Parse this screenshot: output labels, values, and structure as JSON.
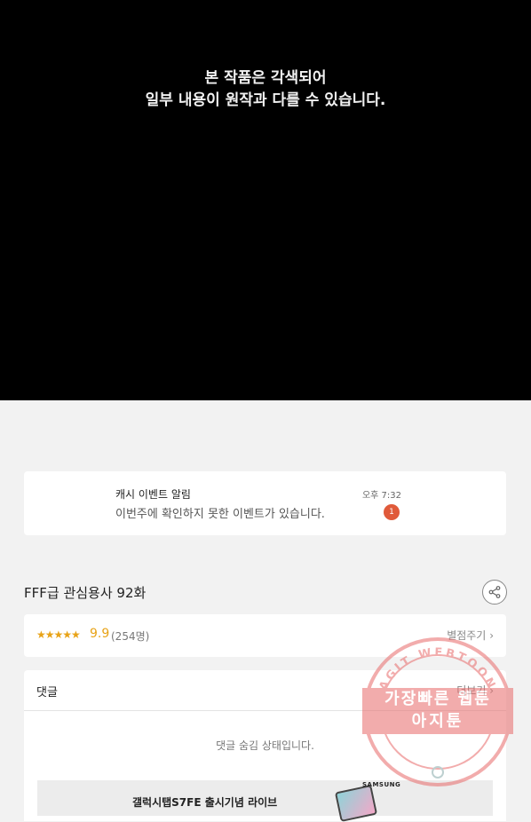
{
  "viewer": {
    "notice_line1": "본 작품은 각색되어",
    "notice_line2": "일부 내용이 원작과 다를 수 있습니다."
  },
  "notification": {
    "title": "캐시 이벤트 알림",
    "message": "이번주에 확인하지 못한 이벤트가 있습니다.",
    "time": "오후 7:32",
    "badge_count": "1",
    "badge_color": "#e05a3a"
  },
  "episode": {
    "title": "FFF급 관심용사 92화",
    "share_icon": "share-icon"
  },
  "rating": {
    "stars": "★★★★★",
    "score": "9.9",
    "count": "(254명)",
    "action_label": "별점주기",
    "accent_color": "#e8a317"
  },
  "comments": {
    "header": "댓글",
    "more_label": "더보기",
    "hidden_message": "댓글 숨김 상태입니다."
  },
  "ad": {
    "brand": "SAMSUNG",
    "text": "갤럭시탭S7FE 출시기념 라이브"
  },
  "watermark": {
    "line1": "가장빠른 웹툰",
    "line2": "아지툰",
    "arc_text": "AGIT WEBTOON",
    "color": "#e86a6a"
  }
}
